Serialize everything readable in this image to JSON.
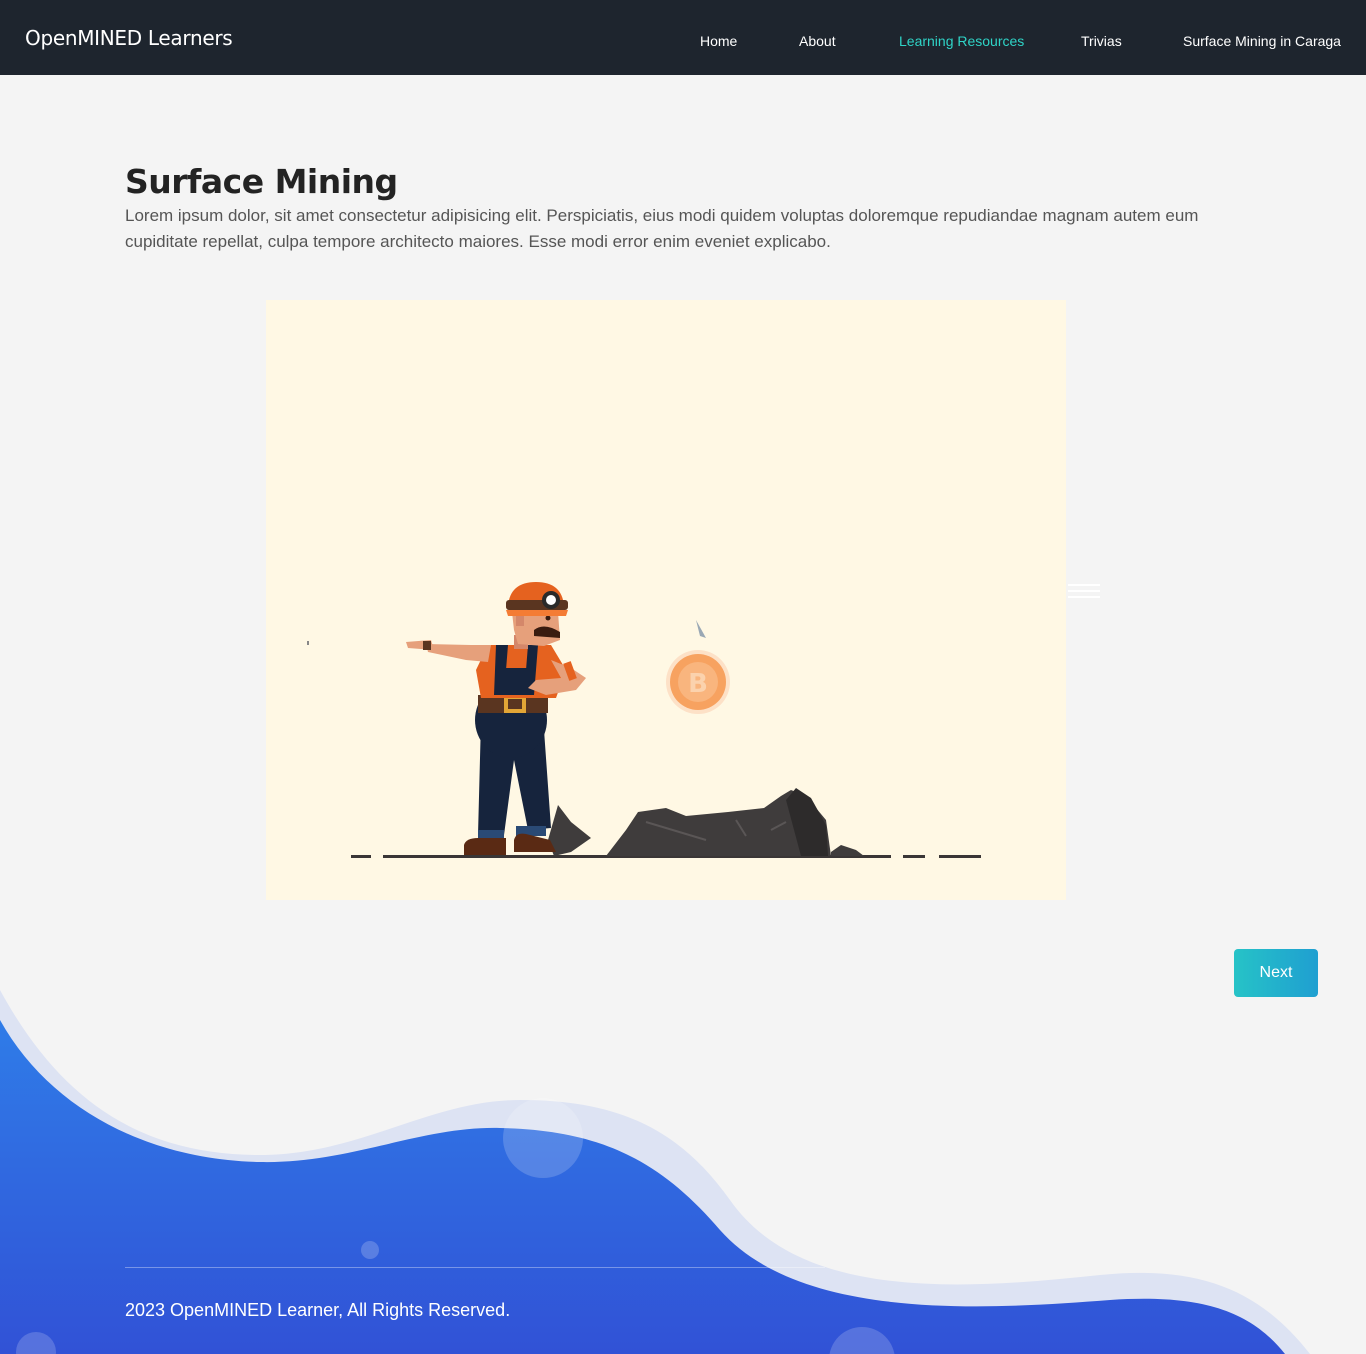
{
  "header": {
    "brand": "OpenMINED Learners",
    "nav": [
      {
        "label": "Home",
        "active": false
      },
      {
        "label": "About",
        "active": false
      },
      {
        "label": "Learning Resources",
        "active": true
      },
      {
        "label": "Trivias",
        "active": false
      },
      {
        "label": "Surface Mining in Caraga",
        "active": false
      }
    ]
  },
  "main": {
    "title": "Surface Mining",
    "description": "Lorem ipsum dolor, sit amet consectetur adipisicing elit. Perspiciatis, eius modi quidem voluptas doloremque repudiandae magnam autem eum cupiditate repellat, culpa tempore architecto maiores. Esse modi error enim eveniet explicabo.",
    "next_label": "Next"
  },
  "footer": {
    "copyright": "2023 OpenMINED Learner, All Rights Reserved."
  },
  "colors": {
    "navbar": "#1e252e",
    "active_link": "#2fd4c7",
    "button_start": "#26c3c7",
    "button_end": "#1f9fd1",
    "footer_blue": "#3461e0",
    "illustration_bg": "#fff8e4"
  }
}
